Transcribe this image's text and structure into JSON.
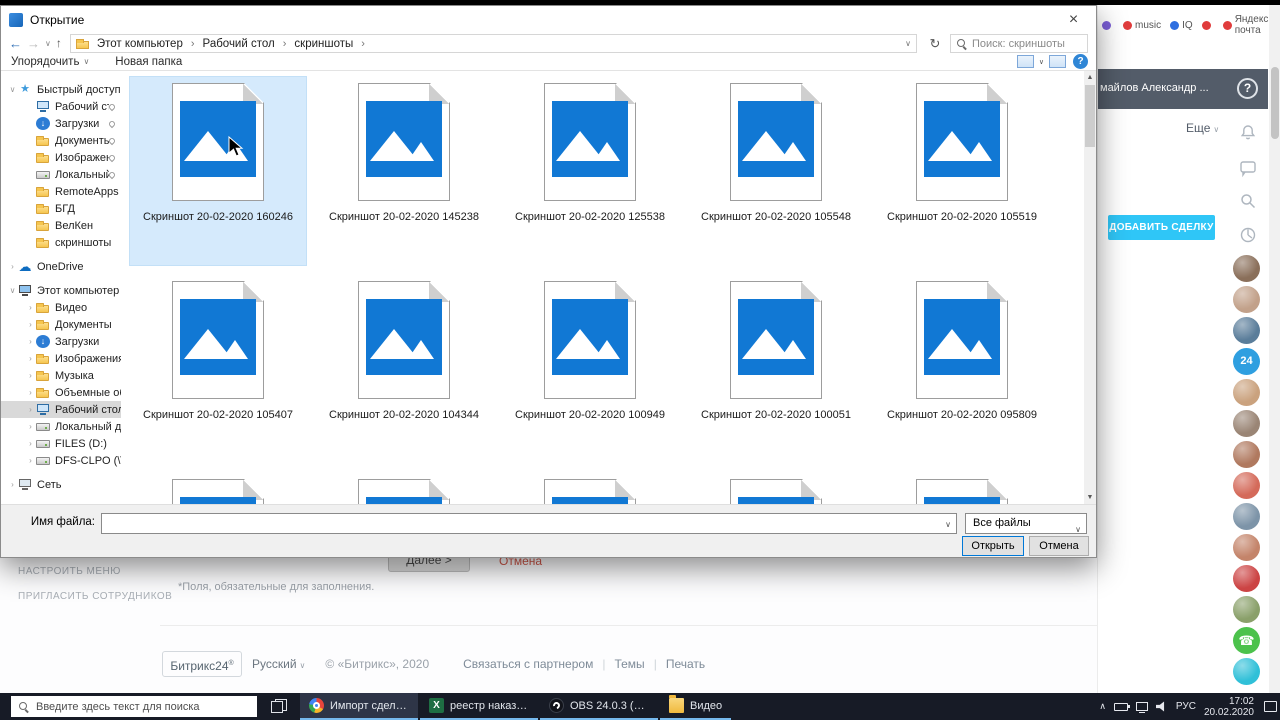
{
  "dialog": {
    "title": "Открытие",
    "icons": {
      "close": "×",
      "back": "←",
      "forward": "→",
      "up": "↑",
      "chevron": "∨",
      "refresh": "↻",
      "crumb_sep": "›",
      "scroll_up": "▲",
      "scroll_down": "▼",
      "help": "?"
    },
    "nav": {
      "breadcrumb": [
        "Этот компьютер",
        "Рабочий стол",
        "скриншоты"
      ],
      "search_placeholder": "Поиск: скриншоты"
    },
    "toolbar": {
      "organize": "Упорядочить",
      "new_folder": "Новая папка"
    },
    "tree": [
      {
        "label": "Быстрый доступ",
        "icon": "star",
        "indent": 0,
        "chev": "v"
      },
      {
        "label": "Рабочий стол",
        "icon": "desktop",
        "indent": 1,
        "pin": true
      },
      {
        "label": "Загрузки",
        "icon": "downloads",
        "indent": 1,
        "pin": true
      },
      {
        "label": "Документы",
        "icon": "documents",
        "indent": 1,
        "pin": true
      },
      {
        "label": "Изображения",
        "icon": "pictures",
        "indent": 1,
        "pin": true
      },
      {
        "label": "Локальный диск",
        "icon": "disk",
        "indent": 1,
        "pin": true
      },
      {
        "label": "RemoteApps",
        "icon": "folder",
        "indent": 1
      },
      {
        "label": "БГД",
        "icon": "folder",
        "indent": 1
      },
      {
        "label": "ВелКен",
        "icon": "folder",
        "indent": 1
      },
      {
        "label": "скриншоты",
        "icon": "folder",
        "indent": 1
      },
      {
        "label": "OneDrive",
        "icon": "cloud",
        "indent": 0,
        "chev": ">"
      },
      {
        "label": "Этот компьютер",
        "icon": "computer",
        "indent": 0,
        "chev": "v"
      },
      {
        "label": "Видео",
        "icon": "video",
        "indent": 1,
        "chev": ">"
      },
      {
        "label": "Документы",
        "icon": "documents",
        "indent": 1,
        "chev": ">"
      },
      {
        "label": "Загрузки",
        "icon": "downloads",
        "indent": 1,
        "chev": ">"
      },
      {
        "label": "Изображения",
        "icon": "pictures",
        "indent": 1,
        "chev": ">"
      },
      {
        "label": "Музыка",
        "icon": "music",
        "indent": 1,
        "chev": ">"
      },
      {
        "label": "Объемные объект",
        "icon": "objects3d",
        "indent": 1,
        "chev": ">"
      },
      {
        "label": "Рабочий стол",
        "icon": "desktop",
        "indent": 1,
        "chev": ">",
        "selected": true
      },
      {
        "label": "Локальный диск (C",
        "icon": "disk",
        "indent": 1,
        "chev": ">"
      },
      {
        "label": "FILES (D:)",
        "icon": "disk",
        "indent": 1,
        "chev": ">"
      },
      {
        "label": "DFS-CLPO (\\\\clpo.l",
        "icon": "disk",
        "indent": 1,
        "chev": ">"
      },
      {
        "label": "Сеть",
        "icon": "network",
        "indent": 0,
        "chev": ">"
      }
    ],
    "files": [
      {
        "name": "Скриншот 20-02-2020 160246",
        "selected": true
      },
      {
        "name": "Скриншот 20-02-2020 145238"
      },
      {
        "name": "Скриншот 20-02-2020 125538"
      },
      {
        "name": "Скриншот 20-02-2020 105548"
      },
      {
        "name": "Скриншот 20-02-2020 105519"
      },
      {
        "name": "Скриншот 20-02-2020 105407"
      },
      {
        "name": "Скриншот 20-02-2020 104344"
      },
      {
        "name": "Скриншот 20-02-2020 100949"
      },
      {
        "name": "Скриншот 20-02-2020 100051"
      },
      {
        "name": "Скриншот 20-02-2020 095809"
      },
      {
        "name": ""
      },
      {
        "name": ""
      },
      {
        "name": ""
      },
      {
        "name": ""
      },
      {
        "name": ""
      }
    ],
    "footer": {
      "filename_label": "Имя файла:",
      "filename_value": "",
      "filetype_value": "Все файлы",
      "open": "Открыть",
      "cancel": "Отмена"
    }
  },
  "page": {
    "bookmarks": [
      {
        "label": "",
        "color": "#7b5fd6"
      },
      {
        "label": "music",
        "color": "#e03c3c"
      },
      {
        "label": "IQ",
        "color": "#2f6fe0"
      },
      {
        "label": "",
        "color": "#e03c3c"
      },
      {
        "label": "Яндекс почта",
        "color": "#e03c3c"
      }
    ],
    "profile": "майлов Александр ...",
    "help_glyph": "?",
    "more": "Еще",
    "caret": "∨",
    "add_deal": "ДОБАВИТЬ СДЕЛКУ",
    "menu_link_1": "НАСТРОИТЬ МЕНЮ",
    "menu_link_2": "ПРИГЛАСИТЬ СОТРУДНИКОВ",
    "next_button": "Далее >",
    "cancel_link": "Отмена",
    "required_note": "*Поля, обязательные для заполнения.",
    "avatars": [
      {
        "type": "photo",
        "color": "#8a6f5a",
        "label": ""
      },
      {
        "type": "photo",
        "color": "#c2a18a",
        "label": ""
      },
      {
        "type": "photo",
        "color": "#5a7d9a",
        "label": ""
      },
      {
        "type": "badge",
        "color": "#2f9fe0",
        "label": "24"
      },
      {
        "type": "photo",
        "color": "#caa27e",
        "label": ""
      },
      {
        "type": "photo",
        "color": "#9a8575",
        "label": ""
      },
      {
        "type": "photo",
        "color": "#b0795f",
        "label": ""
      },
      {
        "type": "photo",
        "color": "#d46a5a",
        "label": ""
      },
      {
        "type": "photo",
        "color": "#7d94a8",
        "label": ""
      },
      {
        "type": "photo",
        "color": "#c4846a",
        "label": ""
      },
      {
        "type": "photo",
        "color": "#cc4444",
        "label": ""
      },
      {
        "type": "photo",
        "color": "#8aa06a",
        "label": ""
      },
      {
        "type": "phone",
        "color": "#4cc24c",
        "label": "☎"
      },
      {
        "type": "photo",
        "color": "#30c0d8",
        "label": ""
      }
    ],
    "footer": {
      "logo": "Битрикс24",
      "logo_sup": "®",
      "lang": "Русский",
      "copyright": "© «Битрикс», 2020",
      "sep": "|",
      "links": [
        "Связаться с партнером",
        "Темы",
        "Печать"
      ]
    }
  },
  "taskbar": {
    "search_placeholder": "Введите здесь текст для поиска",
    "apps": [
      {
        "label": "Импорт сделок - ...",
        "icon": "chrome",
        "active": true
      },
      {
        "label": "реестр наказов де...",
        "icon": "excel"
      },
      {
        "label": "OBS 24.0.3 (64-bit, ...",
        "icon": "obs"
      },
      {
        "label": "Видео",
        "icon": "folder"
      }
    ],
    "tray": {
      "chevron": "∧",
      "lang": "РУС",
      "time": "17:02",
      "date": "20.02.2020"
    }
  },
  "colors": {
    "accent_cyan": "#2fc6f7",
    "file_blue": "#1178d4",
    "header_dark": "#535c69"
  }
}
